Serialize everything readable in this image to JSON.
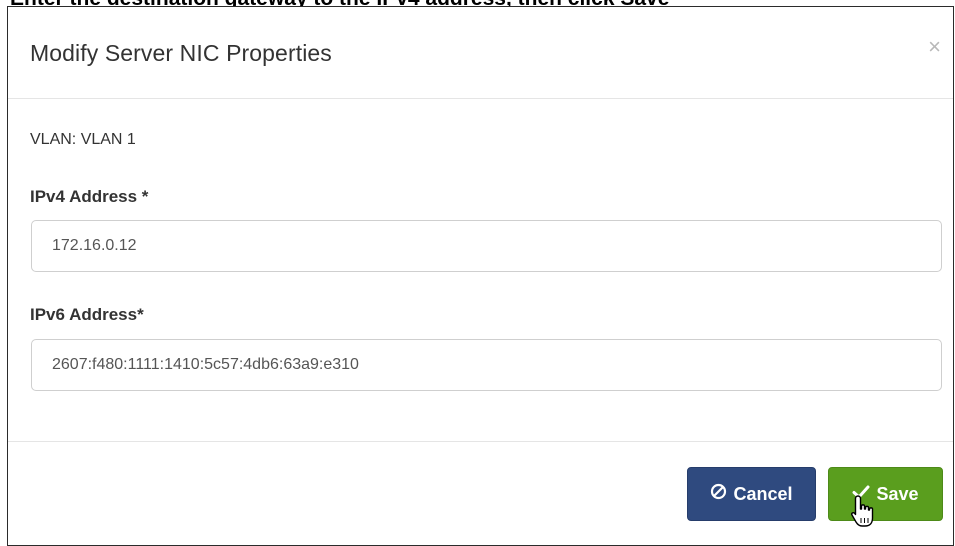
{
  "background_caption": "Enter the destination gateway to the IPv4 address, then click Save",
  "dialog": {
    "title": "Modify Server NIC Properties",
    "close_glyph": "×",
    "vlan_text": "VLAN: VLAN 1",
    "fields": {
      "ipv4": {
        "label": "IPv4 Address *",
        "value": "172.16.0.12"
      },
      "ipv6": {
        "label": "IPv6 Address*",
        "value": "2607:f480:1111:1410:5c57:4db6:63a9:e310"
      }
    },
    "buttons": {
      "cancel": {
        "label": "Cancel",
        "icon": "ban-icon"
      },
      "save": {
        "label": "Save",
        "icon": "check-icon"
      }
    }
  },
  "colors": {
    "cancel_bg": "#2f4a7f",
    "save_bg": "#5a9e1e",
    "title_text": "#333333"
  }
}
